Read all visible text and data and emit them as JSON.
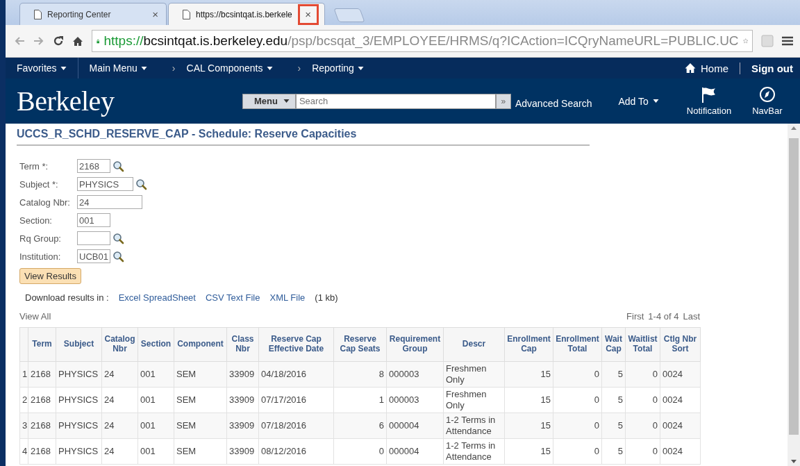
{
  "browser": {
    "tabs": [
      {
        "title": "Reporting Center",
        "selected": false
      },
      {
        "title": "https://bcsintqat.is.berkele",
        "selected": true,
        "close_highlighted": true
      }
    ],
    "close_glyph": "×",
    "address": {
      "scheme": "https://",
      "host": "bcsintqat.is.berkeley.edu",
      "path": "/psp/bcsqat_3/EMPLOYEE/HRMS/q?ICAction=ICQryNameURL=PUBLIC.UC"
    }
  },
  "nav": {
    "left": [
      {
        "label": "Favorites"
      },
      {
        "label": "Main Menu"
      },
      {
        "label": "CAL Components",
        "separator": "›"
      },
      {
        "label": "Reporting",
        "separator": "›"
      }
    ],
    "home": "Home",
    "sign_out": "Sign out"
  },
  "header": {
    "logo": "Berkeley",
    "menu": "Menu",
    "search_placeholder": "Search",
    "search_go": "»",
    "advanced_search": "Advanced Search",
    "add_to": "Add To",
    "notification": "Notification",
    "navbar": "NavBar"
  },
  "title": "UCCS_R_SCHD_RESERVE_CAP - Schedule: Reserve Capacities",
  "fields": [
    {
      "label": "Term *:",
      "value": "2168",
      "lookup": true
    },
    {
      "label": "Subject *:",
      "value": "PHYSICS",
      "lookup": true
    },
    {
      "label": "Catalog Nbr:",
      "value": "24",
      "lookup": false
    },
    {
      "label": "Section:",
      "value": "001",
      "lookup": false
    },
    {
      "label": "Rq Group:",
      "lookup": true
    },
    {
      "label": "Institution:",
      "value": "UCB01",
      "lookup": true
    }
  ],
  "view_results": "View Results",
  "download": {
    "label": "Download results in :",
    "links": [
      "Excel SpreadSheet",
      "CSV Text File",
      "XML File"
    ],
    "size": "(1 kb)"
  },
  "view_all": "View All",
  "pager": {
    "first": "First",
    "range": "1-4 of 4",
    "last": "Last"
  },
  "table": {
    "columns": [
      "Term",
      "Subject",
      "Catalog Nbr",
      "Section",
      "Component",
      "Class Nbr",
      "Reserve Cap Effective Date",
      "Reserve Cap Seats",
      "Requirement Group",
      "Descr",
      "Enrollment Cap",
      "Enrollment Total",
      "Wait Cap",
      "Waitlist Total",
      "Ctlg Nbr Sort"
    ],
    "rows": [
      {
        "number": "1",
        "cells": [
          "2168",
          "PHYSICS",
          "24",
          "001",
          "SEM",
          "33909",
          "04/18/2016",
          "8",
          "000003",
          "Freshmen Only",
          "15",
          "0",
          "5",
          "0",
          "0024"
        ]
      },
      {
        "number": "2",
        "cells": [
          "2168",
          "PHYSICS",
          "24",
          "001",
          "SEM",
          "33909",
          "07/17/2016",
          "1",
          "000003",
          "Freshmen Only",
          "15",
          "0",
          "5",
          "0",
          "0024"
        ]
      },
      {
        "number": "3",
        "cells": [
          "2168",
          "PHYSICS",
          "24",
          "001",
          "SEM",
          "33909",
          "07/18/2016",
          "6",
          "000004",
          "1-2 Terms in Attendance",
          "15",
          "0",
          "5",
          "0",
          "0024"
        ]
      },
      {
        "number": "4",
        "cells": [
          "2168",
          "PHYSICS",
          "24",
          "001",
          "SEM",
          "33909",
          "08/12/2016",
          "0",
          "000004",
          "1-2 Terms in Attendance",
          "15",
          "0",
          "5",
          "0",
          "0024"
        ]
      }
    ]
  }
}
